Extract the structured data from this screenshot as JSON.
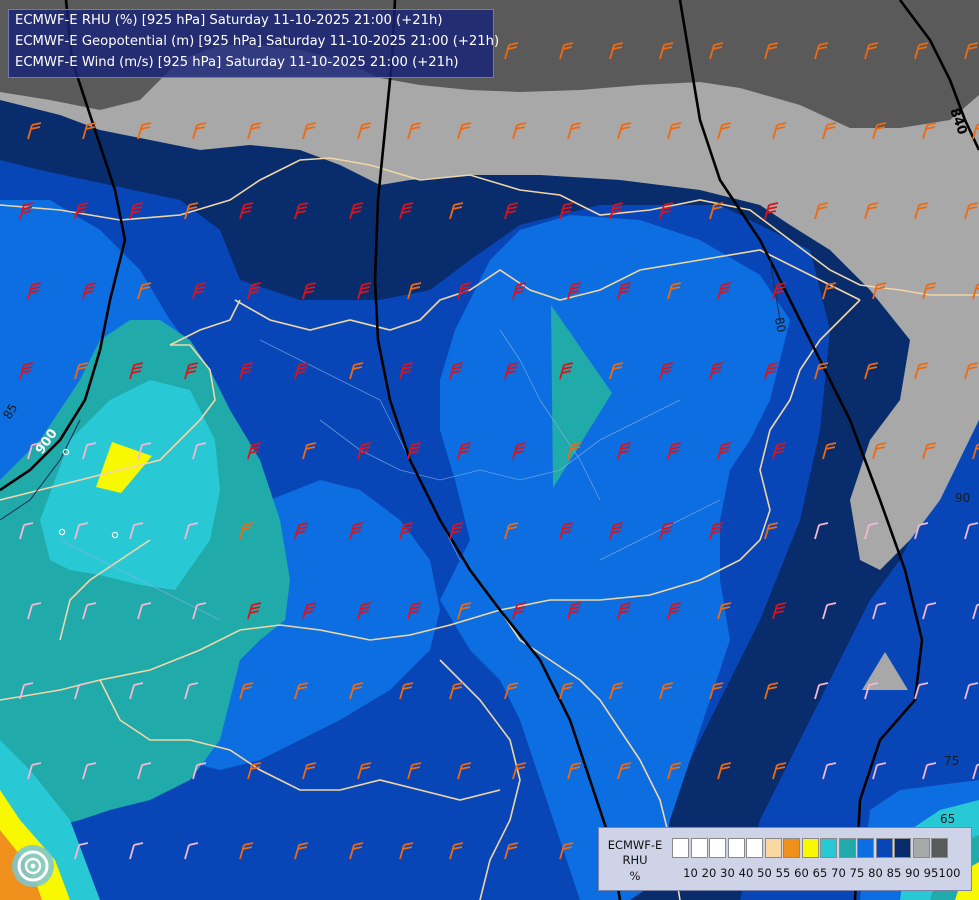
{
  "header": {
    "lines": [
      "ECMWF-E RHU (%) [925 hPa] Saturday 11-10-2025 21:00 (+21h)",
      "ECMWF-E Geopotential (m) [925 hPa] Saturday 11-10-2025 21:00 (+21h)",
      "ECMWF-E Wind (m/s) [925 hPa] Saturday 11-10-2025 21:00 (+21h)"
    ]
  },
  "legend": {
    "title_lines": [
      "ECMWF-E",
      "RHU",
      "%"
    ],
    "ticks": [
      "10",
      "20",
      "30",
      "40",
      "50",
      "55",
      "60",
      "65",
      "70",
      "75",
      "80",
      "85",
      "90",
      "95",
      "100"
    ],
    "colors": [
      "#ffffff",
      "#ffffff",
      "#ffffff",
      "#ffffff",
      "#ffffff",
      "#f8d8a0",
      "#f0901c",
      "#f8f800",
      "#28c8d4",
      "#20aaaa",
      "#0c6ee0",
      "#0846b8",
      "#082c6c",
      "#a8a8a8",
      "#5a5a5a"
    ]
  },
  "contours": {
    "geopotential_labels": [
      "900",
      "840"
    ],
    "rhu_labels": [
      "90",
      "85",
      "80",
      "75",
      "65"
    ]
  },
  "palette": {
    "rhu_60": "#f0901c",
    "rhu_65": "#f8f800",
    "rhu_70": "#28c8d4",
    "rhu_75": "#20aaaa",
    "rhu_80": "#0c6ee0",
    "rhu_85": "#0846b8",
    "rhu_90": "#082c6c",
    "rhu_95": "#a8a8a8",
    "rhu_100": "#5a5a5a",
    "border_color": "#f0d6a8",
    "isohypse_color": "#000000"
  },
  "wind_barb_colors": {
    "strong": "#d8141c",
    "moderate": "#ee6a12",
    "light": "#f4b8d4"
  }
}
